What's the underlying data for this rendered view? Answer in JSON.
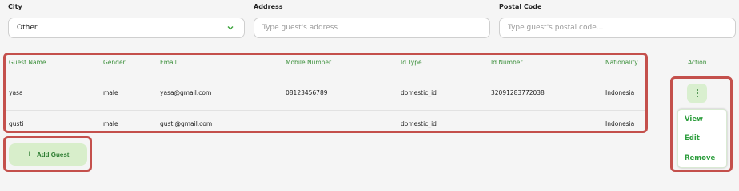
{
  "filters": {
    "city_label": "City",
    "city_value": "Other",
    "address_label": "Address",
    "address_placeholder": "Type guest's address",
    "postal_label": "Postal Code",
    "postal_placeholder": "Type guest's postal code..."
  },
  "table": {
    "headers": [
      "Guest Name",
      "Gender",
      "Email",
      "Mobile Number",
      "Id Type",
      "Id Number",
      "Nationality"
    ],
    "rows": [
      {
        "name": "yasa",
        "gender": "male",
        "email": "yasa@gmail.com",
        "mobile": "08123456789",
        "id_type": "domestic_id",
        "id_number": "32091283772038",
        "nationality": "Indonesia"
      },
      {
        "name": "gusti",
        "gender": "male",
        "email": "gusti@gmail.com",
        "mobile": "",
        "id_type": "domestic_id",
        "id_number": "",
        "nationality": "Indonesia"
      }
    ]
  },
  "action": {
    "header": "Action",
    "menu": [
      "View",
      "Edit",
      "Remove"
    ]
  },
  "add_guest_label": "Add Guest",
  "colors": {
    "accent_green": "#2e9e3e",
    "highlight_red": "#c4504c",
    "button_bg": "#d8eecb"
  },
  "icons": {
    "city_dropdown": "chevron-down-icon",
    "row_actions": "kebab-menu-icon",
    "add": "plus-icon"
  }
}
